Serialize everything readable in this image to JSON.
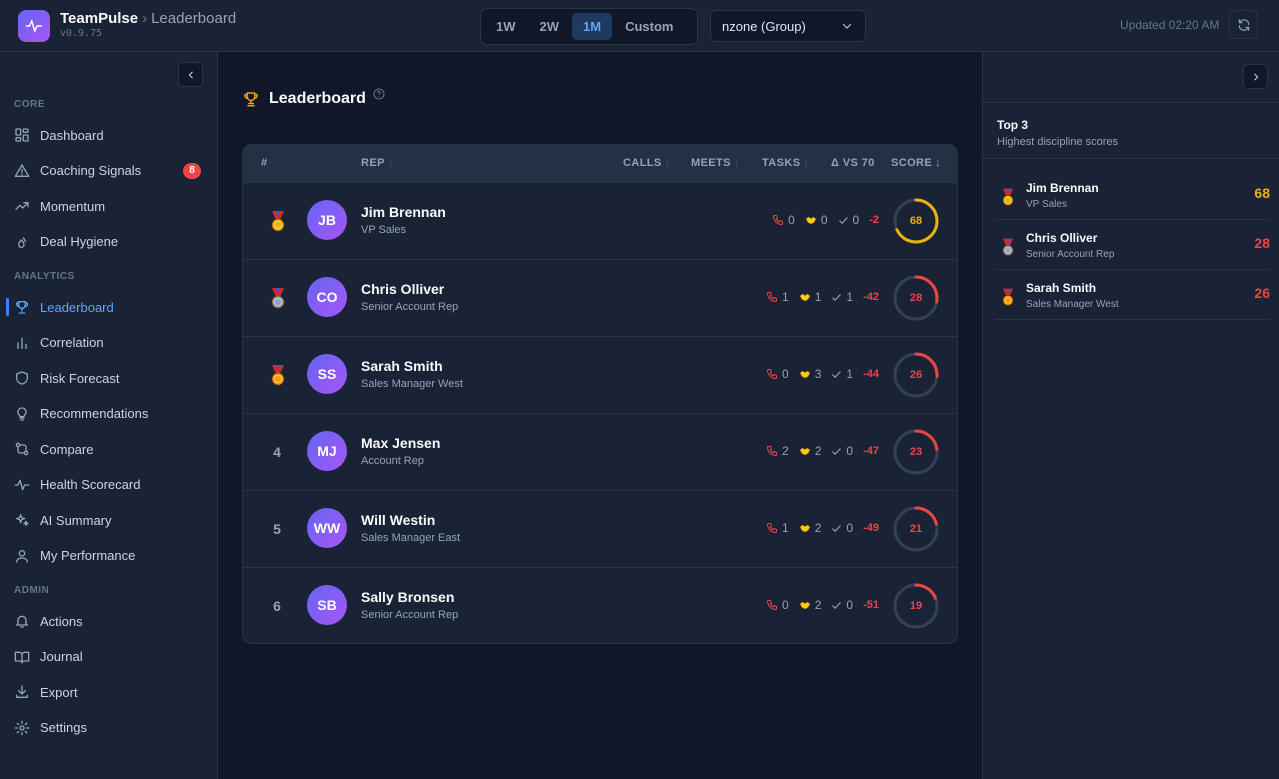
{
  "header": {
    "app_name": "TeamPulse",
    "breadcrumb_sep": "›",
    "breadcrumb": "Leaderboard",
    "version": "v0.9.75",
    "ranges": [
      "1W",
      "2W",
      "1M",
      "Custom"
    ],
    "active_range": "1M",
    "group_select": "nzone (Group)",
    "updated": "Updated 02:20 AM"
  },
  "sidebar": {
    "sections": [
      {
        "label": "CORE",
        "items": [
          {
            "label": "Dashboard",
            "icon": "grid-icon"
          },
          {
            "label": "Coaching Signals",
            "icon": "alert-triangle-icon",
            "badge": "8"
          },
          {
            "label": "Momentum",
            "icon": "trending-up-icon"
          },
          {
            "label": "Deal Hygiene",
            "icon": "droplets-icon"
          }
        ]
      },
      {
        "label": "ANALYTICS",
        "items": [
          {
            "label": "Leaderboard",
            "icon": "trophy-icon",
            "active": true
          },
          {
            "label": "Correlation",
            "icon": "bar-chart-icon"
          },
          {
            "label": "Risk Forecast",
            "icon": "shield-icon"
          },
          {
            "label": "Recommendations",
            "icon": "lightbulb-icon"
          },
          {
            "label": "Compare",
            "icon": "git-compare-icon"
          },
          {
            "label": "Health Scorecard",
            "icon": "activity-icon"
          },
          {
            "label": "AI Summary",
            "icon": "sparkles-icon"
          },
          {
            "label": "My Performance",
            "icon": "user-icon"
          }
        ]
      },
      {
        "label": "ADMIN",
        "items": [
          {
            "label": "Actions",
            "icon": "bell-icon"
          },
          {
            "label": "Journal",
            "icon": "book-icon"
          },
          {
            "label": "Export",
            "icon": "download-icon"
          },
          {
            "label": "Settings",
            "icon": "gear-icon"
          }
        ]
      }
    ]
  },
  "main": {
    "title": "Leaderboard",
    "columns": {
      "rank": "#",
      "rep": "REP",
      "calls": "CALLS",
      "meets": "MEETS",
      "tasks": "TASKS",
      "delta": "Δ VS 70",
      "score": "SCORE"
    },
    "sort_asc_glyph": "↕",
    "sort_desc_glyph": "↓",
    "rows": [
      {
        "rank": "1",
        "medal": "gold",
        "initials": "JB",
        "name": "Jim Brennan",
        "role": "VP Sales",
        "calls": "0",
        "meets": "0",
        "tasks": "0",
        "delta": "-2",
        "score": 68
      },
      {
        "rank": "2",
        "medal": "silver",
        "initials": "CO",
        "name": "Chris Olliver",
        "role": "Senior Account Rep",
        "calls": "1",
        "meets": "1",
        "tasks": "1",
        "delta": "-42",
        "score": 28
      },
      {
        "rank": "3",
        "medal": "bronze",
        "initials": "SS",
        "name": "Sarah Smith",
        "role": "Sales Manager West",
        "calls": "0",
        "meets": "3",
        "tasks": "1",
        "delta": "-44",
        "score": 26
      },
      {
        "rank": "4",
        "medal": null,
        "initials": "MJ",
        "name": "Max Jensen",
        "role": "Account Rep",
        "calls": "2",
        "meets": "2",
        "tasks": "0",
        "delta": "-47",
        "score": 23
      },
      {
        "rank": "5",
        "medal": null,
        "initials": "WW",
        "name": "Will Westin",
        "role": "Sales Manager East",
        "calls": "1",
        "meets": "2",
        "tasks": "0",
        "delta": "-49",
        "score": 21
      },
      {
        "rank": "6",
        "medal": null,
        "initials": "SB",
        "name": "Sally Bronsen",
        "role": "Senior Account Rep",
        "calls": "0",
        "meets": "2",
        "tasks": "0",
        "delta": "-51",
        "score": 19
      }
    ]
  },
  "right_panel": {
    "title": "Top 3",
    "subtitle": "Highest discipline scores",
    "items": [
      {
        "medal": "gold",
        "name": "Jim Brennan",
        "role": "VP Sales",
        "score": "68"
      },
      {
        "medal": "silver",
        "name": "Chris Olliver",
        "role": "Senior Account Rep",
        "score": "28"
      },
      {
        "medal": "bronze",
        "name": "Sarah Smith",
        "role": "Sales Manager West",
        "score": "26"
      }
    ]
  },
  "colors": {
    "accent": "#3b82f6",
    "score_high": "#eab308",
    "score_low": "#ef4444",
    "ring_track": "#334155",
    "medal_gold": "#eab308",
    "medal_silver": "#94a3b8",
    "medal_bronze": "#f59e0b"
  }
}
